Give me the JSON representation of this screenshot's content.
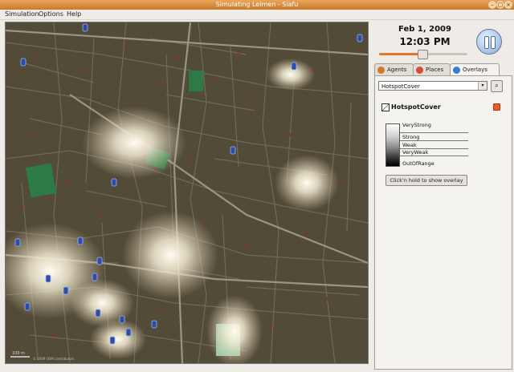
{
  "window": {
    "title": "Simulating Leimen - Siafu",
    "buttons": [
      "–",
      "▢",
      "×"
    ]
  },
  "menu": {
    "items": [
      "Simulation",
      "Options",
      "Help"
    ]
  },
  "map": {
    "scale_label": "100 m",
    "copyright": "© 2009 OSM contributors"
  },
  "clock": {
    "date": "Feb 1, 2009",
    "time": "12:03 PM",
    "progress": 0.46
  },
  "tabs": [
    {
      "label": "Agents",
      "icon": "agent-icon",
      "color": "#d4782c"
    },
    {
      "label": "Places",
      "icon": "places-icon",
      "color": "#d64a3a"
    },
    {
      "label": "Overlays",
      "icon": "overlays-icon",
      "color": "#3a7ad6"
    }
  ],
  "overlay": {
    "selected": "HotspotCover",
    "title": "HotspotCover",
    "legend": [
      "VeryStrong",
      "Strong",
      "Weak",
      "VeryWeak",
      "OutOfRange"
    ],
    "show_button": "Click'n hold to show overlay"
  },
  "colors": {
    "titlebar": "#d98a3c",
    "accent": "#e8762a",
    "map_bg": "#504a36",
    "park": "#2e8a4a"
  }
}
